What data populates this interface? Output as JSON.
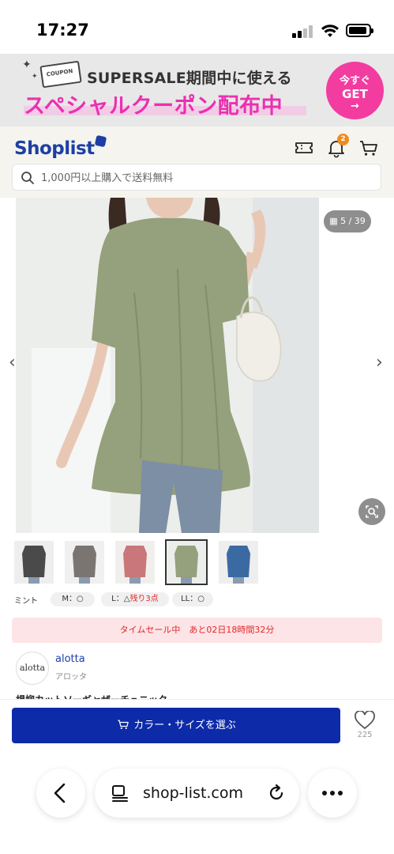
{
  "status_bar": {
    "time": "17:27"
  },
  "promo": {
    "coupon_label": "COUPON",
    "line1": "SUPERSALE期間中に使える",
    "line2": "スペシャルクーポン配布中",
    "cta_line1": "今すぐ",
    "cta_line2": "GET",
    "cta_line3": "→",
    "accent_color": "#ec2fb0"
  },
  "header": {
    "logo": "Shoplist",
    "icons": [
      "coupon-icon",
      "bell-icon",
      "cart-icon"
    ],
    "notification_count": "2",
    "search_placeholder": "1,000円以上購入で送料無料"
  },
  "gallery": {
    "counter": "5 / 39",
    "prev_arrow": "‹",
    "next_arrow": "›"
  },
  "thumbnails": [
    "charcoal",
    "gray",
    "pink",
    "mint",
    "blue"
  ],
  "variant": {
    "color_name": "ミント",
    "sizes": [
      {
        "label": "M：○",
        "low": ""
      },
      {
        "label": "L：△",
        "low": "残り3点"
      },
      {
        "label": "LL：○",
        "low": ""
      }
    ]
  },
  "timesale": {
    "text": "タイムセール中　あと02日18時間32分"
  },
  "brand": {
    "logo_text": "alotta",
    "name": "alotta",
    "kana": "アロッタ"
  },
  "product": {
    "title": "楊柳カットソーギャザーチュニック"
  },
  "buy_bar": {
    "select_label": "カラー・サイズを選ぶ",
    "favorite_count": "225",
    "button_color": "#0d2aa8"
  },
  "browser": {
    "url": "shop-list.com"
  }
}
